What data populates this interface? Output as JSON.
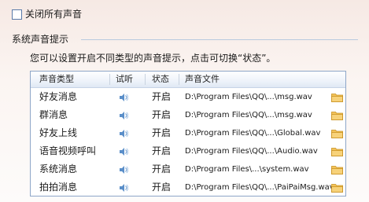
{
  "mute_all": {
    "label": "关闭所有声音",
    "checked": false
  },
  "section": {
    "title": "系统声音提示",
    "description": "您可以设置开启不同类型的声音提示，点击可切换“状态”。"
  },
  "table": {
    "columns": [
      "声音类型",
      "试听",
      "状态",
      "声音文件"
    ],
    "rows": [
      {
        "type": "好友消息",
        "status": "开启",
        "file": "D:\\Program Files\\QQ\\...\\msg.wav"
      },
      {
        "type": "群消息",
        "status": "开启",
        "file": "D:\\Program Files\\QQ\\...\\msg.wav"
      },
      {
        "type": "好友上线",
        "status": "开启",
        "file": "D:\\Program Files\\QQ\\...\\Global.wav"
      },
      {
        "type": "语音视频呼叫",
        "status": "开启",
        "file": "D:\\Program Files\\QQ\\...\\Audio.wav"
      },
      {
        "type": "系统消息",
        "status": "开启",
        "file": "D:\\Program Files\\...\\system.wav"
      },
      {
        "type": "拍拍消息",
        "status": "开启",
        "file": "D:\\Program Files\\QQ\\...\\PaiPaiMsg.wav"
      }
    ]
  },
  "colors": {
    "accent_border": "#8ea6c8",
    "folder": "#f0b43c",
    "speaker": "#5b8fc9"
  },
  "icons": {
    "play": "speaker-icon",
    "browse": "folder-icon"
  }
}
